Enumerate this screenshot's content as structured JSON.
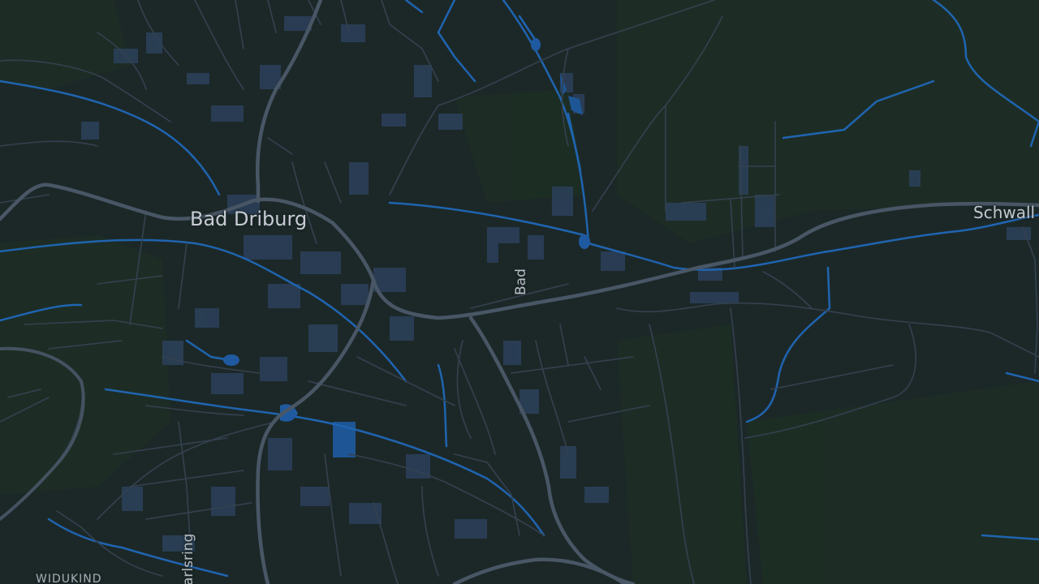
{
  "map": {
    "theme": "dark",
    "colors": {
      "background": "#1c2828",
      "woodland": "#1d2d25",
      "water": "#1f64b0",
      "road": "#3b4a59",
      "major_road": "#4a5766",
      "building": "#2a3d55",
      "label": "#c7cbd4"
    }
  },
  "labels": {
    "town": "Bad Driburg",
    "village": "Schwall",
    "street_bad": "Bad",
    "street_karlsring": "arlsring",
    "district": "WIDUKIND"
  }
}
